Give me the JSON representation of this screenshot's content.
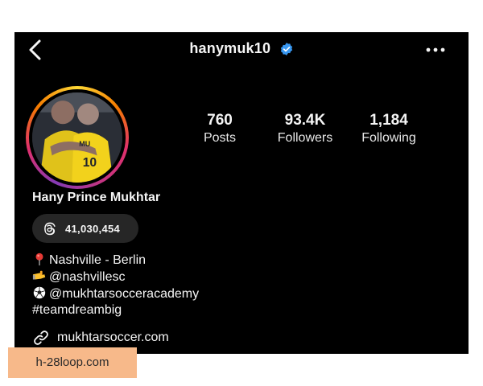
{
  "header": {
    "username": "hanymuk10",
    "back_icon": "chevron-left-icon",
    "verified_icon": "verified-badge-icon",
    "more_icon": "more-horizontal-icon"
  },
  "stats": {
    "posts_value": "760",
    "posts_label": "Posts",
    "followers_value": "93.4K",
    "followers_label": "Followers",
    "following_value": "1,184",
    "following_label": "Following"
  },
  "profile": {
    "display_name": "Hany Prince Mukhtar",
    "threads_count": "41,030,454",
    "threads_icon": "threads-icon",
    "bio_location": "Nashville - Berlin",
    "bio_location_icon": "pin-icon",
    "bio_club": "@nashvillesc",
    "bio_club_icon": "hand-emoji-icon",
    "bio_academy": "@mukhtarsocceracademy",
    "bio_academy_icon": "soccer-ball-icon",
    "bio_hashtag": "#teamdreambig",
    "link": "mukhtarsoccer.com",
    "link_icon": "link-icon"
  },
  "watermark": "h-28loop.com",
  "colors": {
    "background": "#000000",
    "text": "#f5f5f5",
    "verified": "#3897f0",
    "pill": "#262626",
    "watermark_bg": "#f7b98a"
  }
}
